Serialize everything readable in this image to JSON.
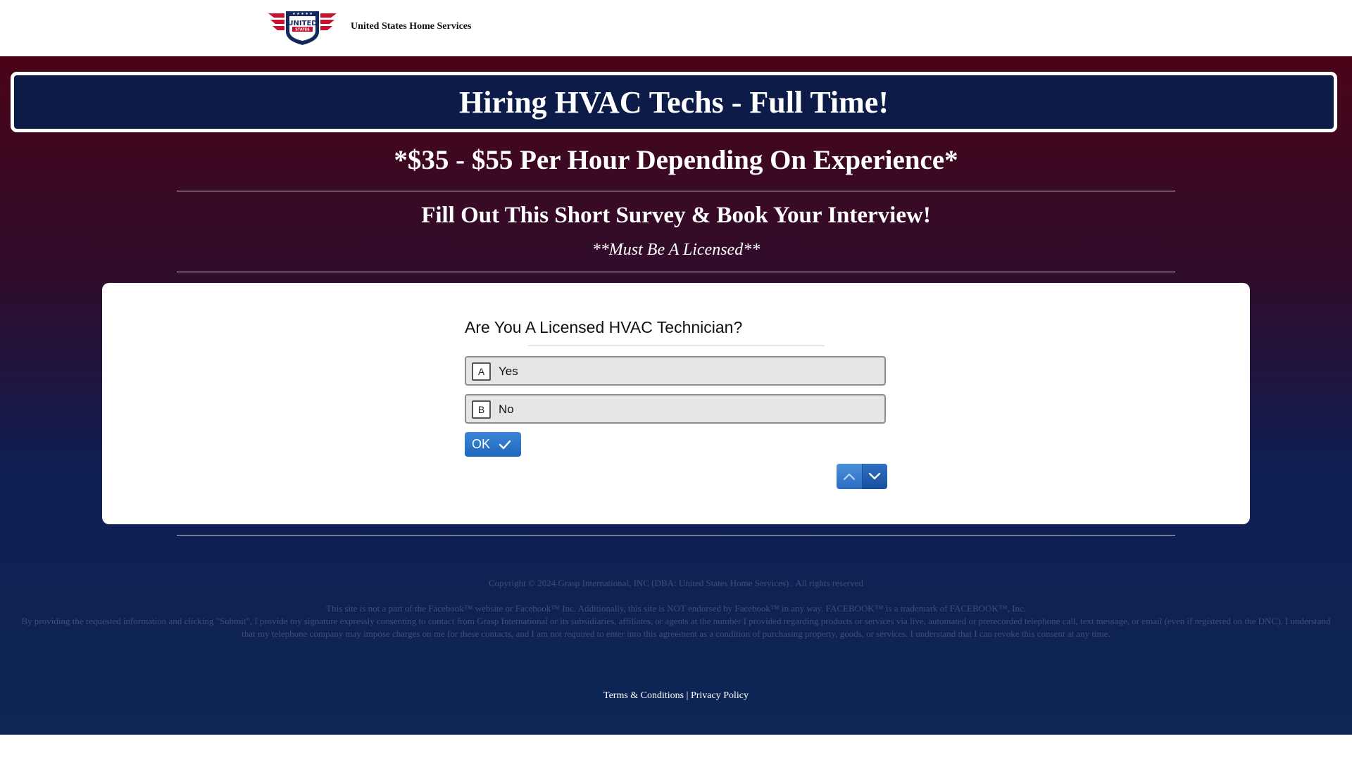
{
  "brand": {
    "name": "United States Home Services",
    "logo_text": "UNITED STATES"
  },
  "hero": {
    "title": "Hiring HVAC Techs - Full Time!",
    "pay": "*$35 - $55 Per Hour Depending On Experience*",
    "cta": "Fill Out This Short Survey & Book Your Interview!",
    "requirement": "**Must Be A Licensed**"
  },
  "survey": {
    "question": "Are You A Licensed HVAC Technician?",
    "options": [
      {
        "key": "A",
        "label": "Yes"
      },
      {
        "key": "B",
        "label": "No"
      }
    ],
    "ok_label": "OK"
  },
  "footer": {
    "copyright": "Copyright © 2024 Grasp International, INC (DBA: United States Home Services) . All rights reserved",
    "disclaimer": "This site is not a part of the Facebook™ website or Facebook™ Inc. Additionally, this site is NOT endorsed by Facebook™ in any way. FACEBOOK™ is a trademark of FACEBOOK™, Inc.",
    "consent": "By providing the requested information and clicking \"Submit\", I provide my signature expressly consenting to contact from Grasp International or its subsidiaries, affiliates, or agents at the number I provided regarding products or services via live, automated or prerecorded telephone call, text message, or email (even if registered on the DNC). I understand that my telephone company may impose charges on me for these contacts, and I am not required to enter into this agreement as a condition of purchasing property, goods, or services. I understand that I can revoke this consent at any time.",
    "terms_label": "Terms & Conditions",
    "separator": "|",
    "privacy_label": "Privacy Policy"
  },
  "colors": {
    "accent_blue": "#1f66bd",
    "navy": "#0d1b48",
    "maroon": "#4a0418"
  },
  "icons": {
    "ok": "check-icon",
    "prev": "chevron-up-icon",
    "next": "chevron-down-icon"
  }
}
